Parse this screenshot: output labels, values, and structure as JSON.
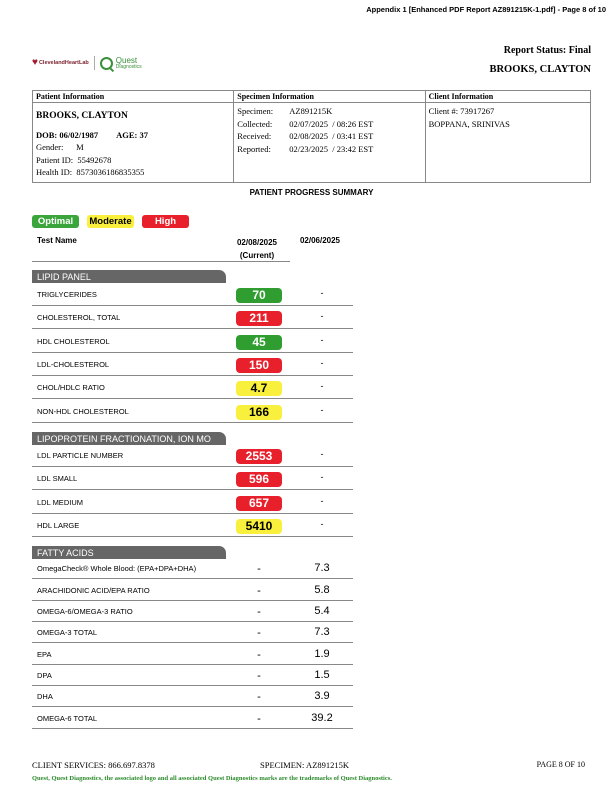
{
  "page_title": "Appendix 1 [Enhanced PDF Report AZ891215K-1.pdf] - Page 8 of 10",
  "logo": {
    "cleveland": "ClevelandHeartLab",
    "cleveland_tag": "A Quest Company",
    "quest": "Quest",
    "quest_sub": "Diagnostics"
  },
  "header": {
    "report_status": "Report Status: Final",
    "patient_name": "BROOKS, CLAYTON"
  },
  "patient": {
    "heading": "Patient Information",
    "name": "BROOKS, CLAYTON",
    "dob": "DOB: 06/02/1987",
    "age": "AGE: 37",
    "gender": "Gender:      M",
    "patient_id": "Patient ID:  55492678",
    "health_id": "Health ID:  8573036186835355"
  },
  "specimen": {
    "heading": "Specimen Information",
    "rows": [
      {
        "label": "Specimen:",
        "value": "AZ891215K"
      },
      {
        "label": "Collected:",
        "value": "02/07/2025  / 08:26 EST"
      },
      {
        "label": "Received:",
        "value": "02/08/2025  / 03:41 EST"
      },
      {
        "label": "Reported:",
        "value": "02/23/2025  / 23:42 EST"
      }
    ]
  },
  "client": {
    "heading": "Client Information",
    "number": "Client #: 73917267",
    "physician": "BOPPANA, SRINIVAS"
  },
  "summary_title": "PATIENT PROGRESS SUMMARY",
  "legend": {
    "optimal": "Optimal",
    "moderate": "Moderate",
    "high": "High",
    "colors": {
      "optimal": "#3aa53a",
      "moderate": "#f8f03c",
      "high": "#e8202c"
    }
  },
  "columns": {
    "test": "Test Name",
    "current_date": "02/08/2025",
    "current_tag": "(Current)",
    "previous_date": "02/06/2025"
  },
  "sections": [
    {
      "title": "LIPID PANEL",
      "rows": [
        {
          "name": "TRIGLYCERIDES",
          "current": "70",
          "status": "optimal",
          "previous": "-"
        },
        {
          "name": "CHOLESTEROL, TOTAL",
          "current": "211",
          "status": "high",
          "previous": "-"
        },
        {
          "name": "HDL CHOLESTEROL",
          "current": "45",
          "status": "optimal",
          "previous": "-"
        },
        {
          "name": "LDL-CHOLESTEROL",
          "current": "150",
          "status": "high",
          "previous": "-"
        },
        {
          "name": "CHOL/HDLC RATIO",
          "current": "4.7",
          "status": "moderate",
          "previous": "-"
        },
        {
          "name": "NON-HDL CHOLESTEROL",
          "current": "166",
          "status": "moderate",
          "previous": "-"
        }
      ]
    },
    {
      "title": "LIPOPROTEIN FRACTIONATION, ION MO",
      "rows": [
        {
          "name": "LDL PARTICLE NUMBER",
          "current": "2553",
          "status": "high",
          "previous": "-"
        },
        {
          "name": "LDL SMALL",
          "current": "596",
          "status": "high",
          "previous": "-"
        },
        {
          "name": "LDL MEDIUM",
          "current": "657",
          "status": "high",
          "previous": "-"
        },
        {
          "name": "HDL LARGE",
          "current": "5410",
          "status": "moderate",
          "previous": "-"
        }
      ]
    },
    {
      "title": "FATTY ACIDS",
      "rows": [
        {
          "name": "OmegaCheck® Whole Blood: (EPA+DPA+DHA)",
          "current": "-",
          "status": "none",
          "previous": "7.3"
        },
        {
          "name": "ARACHIDONIC ACID/EPA RATIO",
          "current": "-",
          "status": "none",
          "previous": "5.8"
        },
        {
          "name": "OMEGA-6/OMEGA-3 RATIO",
          "current": "-",
          "status": "none",
          "previous": "5.4"
        },
        {
          "name": "OMEGA-3 TOTAL",
          "current": "-",
          "status": "none",
          "previous": "7.3"
        },
        {
          "name": "EPA",
          "current": "-",
          "status": "none",
          "previous": "1.9"
        },
        {
          "name": "DPA",
          "current": "-",
          "status": "none",
          "previous": "1.5"
        },
        {
          "name": "DHA",
          "current": "-",
          "status": "none",
          "previous": "3.9"
        },
        {
          "name": "OMEGA-6 TOTAL",
          "current": "-",
          "status": "none",
          "previous": "39.2"
        }
      ]
    }
  ],
  "footer": {
    "client_services": "CLIENT SERVICES: 866.697.8378",
    "specimen": "SPECIMEN: AZ891215K",
    "page": "PAGE 8 OF 10",
    "trademark": "Quest, Quest Diagnostics, the associated logo and all associated Quest Diagnostics marks are the trademarks of Quest Diagnostics."
  }
}
